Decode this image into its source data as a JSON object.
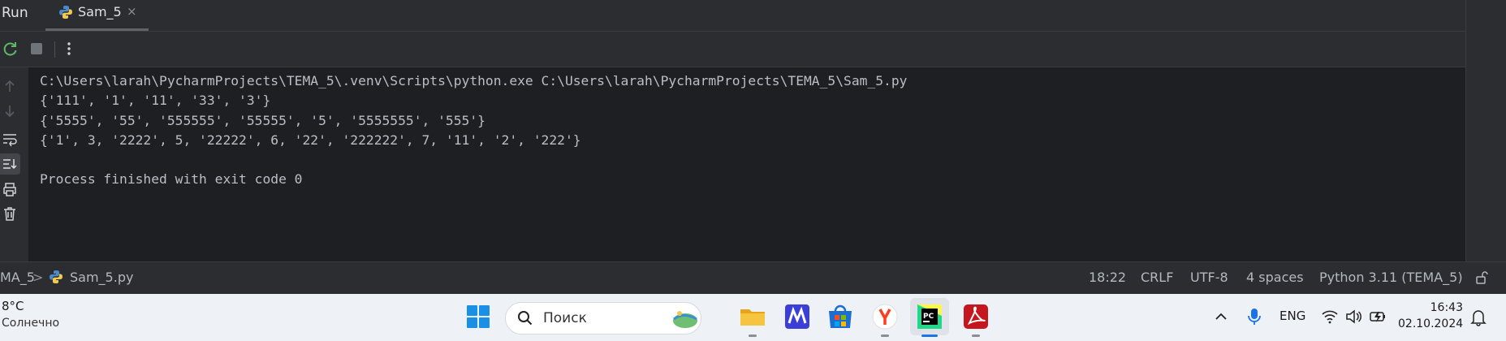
{
  "run_panel": {
    "title": "Run",
    "tab": {
      "label": "Sam_5",
      "close": "×"
    }
  },
  "toolbar": {
    "rerun_icon": "rerun-icon",
    "stop_icon": "stop-icon",
    "more_icon": "more-vertical-icon"
  },
  "gutter_icons": [
    "arrow-up-icon",
    "arrow-down-icon",
    "soft-wrap-icon",
    "scroll-to-end-icon",
    "print-icon",
    "trash-icon"
  ],
  "console": {
    "lines": [
      "C:\\Users\\larah\\PycharmProjects\\TEMA_5\\.venv\\Scripts\\python.exe C:\\Users\\larah\\PycharmProjects\\TEMA_5\\Sam_5.py",
      "{'111', '1', '11', '33', '3'}",
      "{'5555', '55', '555555', '55555', '5', '5555555', '555'}",
      "{'1', 3, '2222', 5, '22222', 6, '22', '222222', 7, '11', '2', '222'}",
      "",
      "Process finished with exit code 0"
    ]
  },
  "statusbar": {
    "breadcrumb_project": "MA_5",
    "breadcrumb_sep": ">",
    "breadcrumb_file": "Sam_5.py",
    "position": "18:22",
    "line_sep": "CRLF",
    "encoding": "UTF-8",
    "indent": "4 spaces",
    "interpreter": "Python 3.11 (TEMA_5)"
  },
  "taskbar": {
    "weather_temp": "8°C",
    "weather_desc": "Солнечно",
    "search_placeholder": "Поиск",
    "apps": [
      "windows-start-icon",
      "file-explorer-icon",
      "m-app-icon",
      "microsoft-store-icon",
      "yandex-browser-icon",
      "pycharm-icon",
      "acrobat-icon"
    ],
    "lang": "ENG",
    "time": "16:43",
    "date": "02.10.2024"
  }
}
